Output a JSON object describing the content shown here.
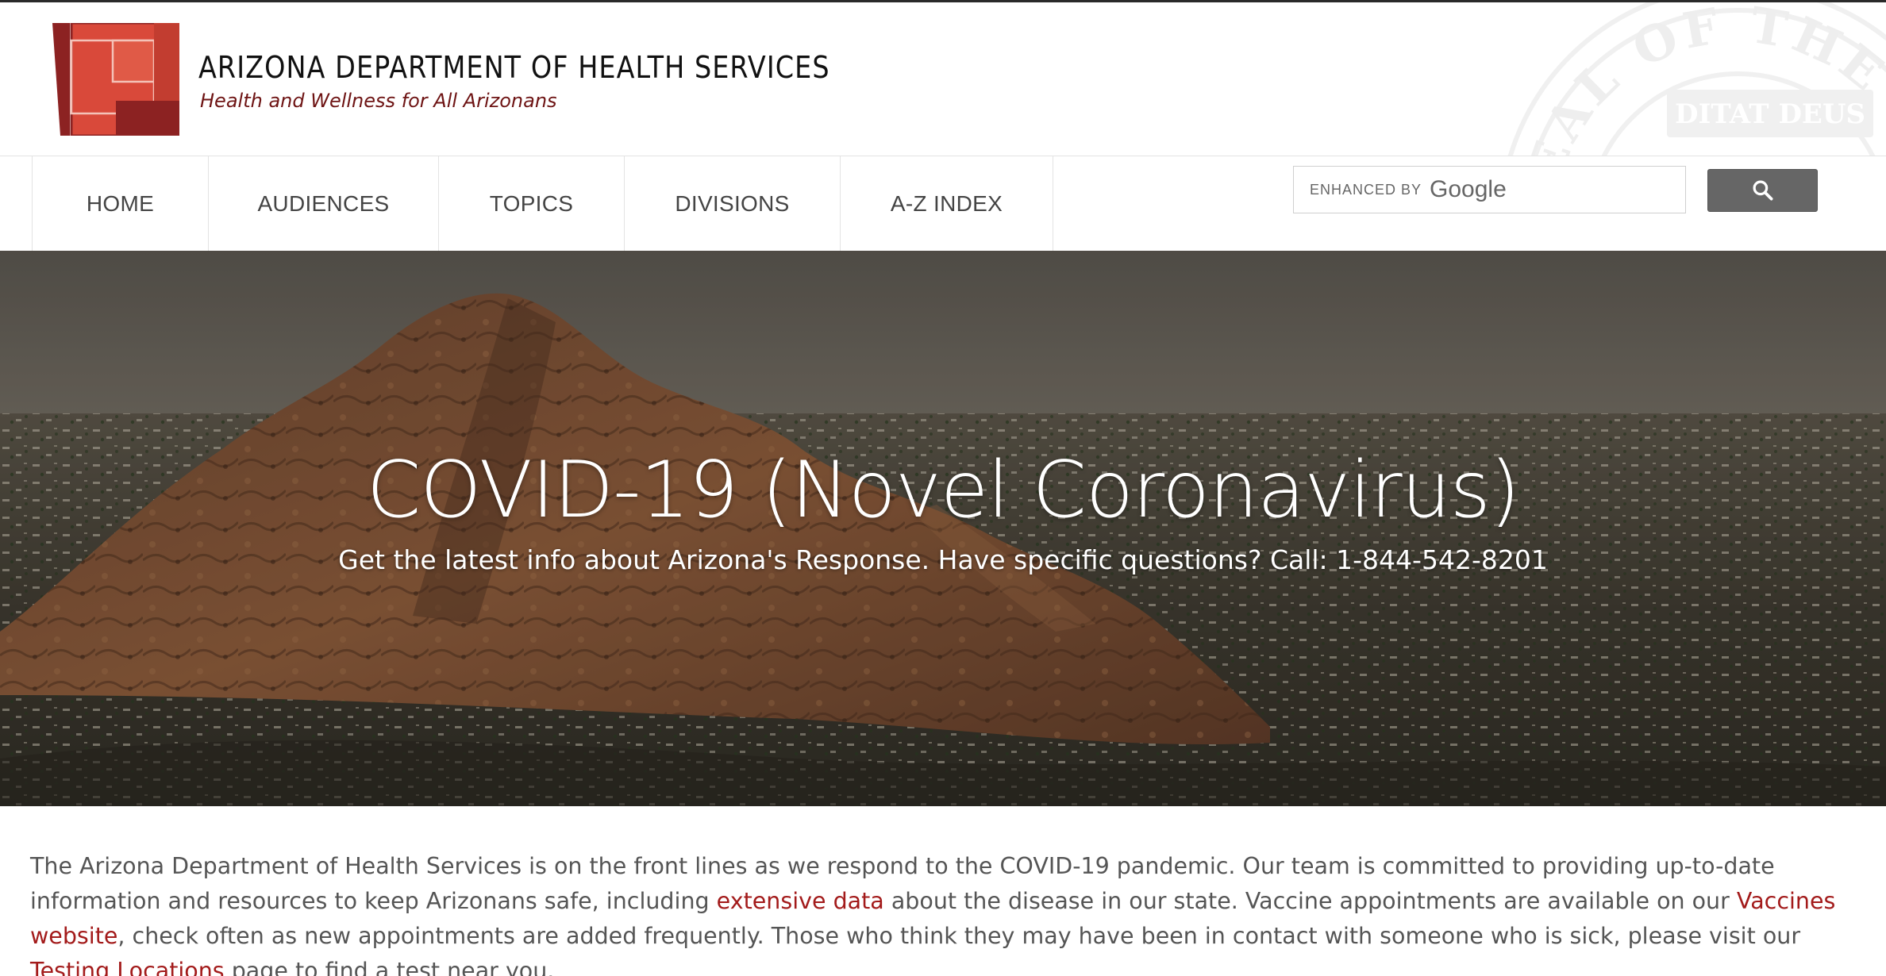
{
  "header": {
    "agency_name": "ARIZONA DEPARTMENT OF HEALTH SERVICES",
    "tagline": "Health and Wellness for All Arizonans",
    "seal_text": "SEAL OF THE STATE OF ARIZONA DITAT DEUS"
  },
  "nav": {
    "items": [
      {
        "label": "HOME"
      },
      {
        "label": "AUDIENCES"
      },
      {
        "label": "TOPICS"
      },
      {
        "label": "DIVISIONS"
      },
      {
        "label": "A-Z INDEX"
      }
    ]
  },
  "search": {
    "enhanced_by": "ENHANCED BY",
    "provider": "Google",
    "value": "",
    "icon": "search-icon"
  },
  "hero": {
    "title": "COVID-19 (Novel Coronavirus)",
    "subtitle": "Get the latest info about Arizona's Response. Have specific questions? Call: 1-844-542-8201"
  },
  "intro": {
    "text_1": "The Arizona Department of Health Services is on the front lines as we respond to the COVID-19 pandemic. Our team is committed to providing up-to-date information and resources to keep Arizonans safe, including ",
    "link_1": "extensive data",
    "text_2": " about the disease in our state. Vaccine appointments are available on our ",
    "link_2": "Vaccines website",
    "text_3": ", check often as new appointments are added frequently. Those who think they may have been in contact with someone who is sick, please visit our ",
    "link_3": "Testing Locations",
    "text_4": " page to find a test near you."
  },
  "colors": {
    "brand_red": "#d9493a",
    "brand_dark_red": "#8c2222",
    "link_red": "#a31b1b",
    "tagline_red": "#6e1414",
    "search_button": "#666666"
  }
}
